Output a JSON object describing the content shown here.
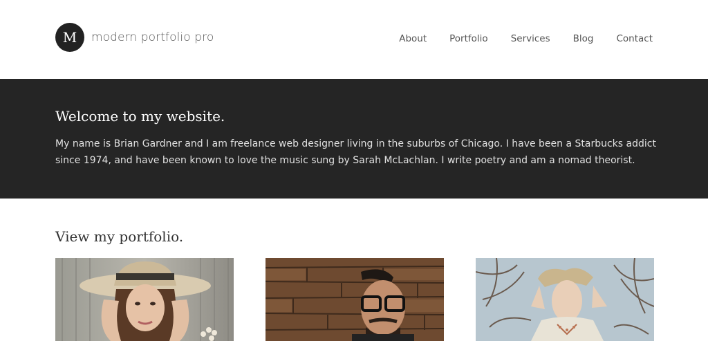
{
  "site": {
    "logo_letter": "M",
    "title": "modern portfolio pro"
  },
  "nav": {
    "items": [
      {
        "label": "About"
      },
      {
        "label": "Portfolio"
      },
      {
        "label": "Services"
      },
      {
        "label": "Blog"
      },
      {
        "label": "Contact"
      }
    ]
  },
  "welcome": {
    "heading": "Welcome to my website.",
    "body": "My name is Brian Gardner and I am freelance web designer living in the suburbs of Chicago. I have been a Starbucks addict since 1974, and have been known to love the music sung by Sarah McLachlan. I write poetry and am a nomad theorist."
  },
  "portfolio": {
    "heading": "View my portfolio."
  },
  "colors": {
    "dark_band": "#252525",
    "logo_circle": "#222222",
    "nav_text": "#555555"
  }
}
